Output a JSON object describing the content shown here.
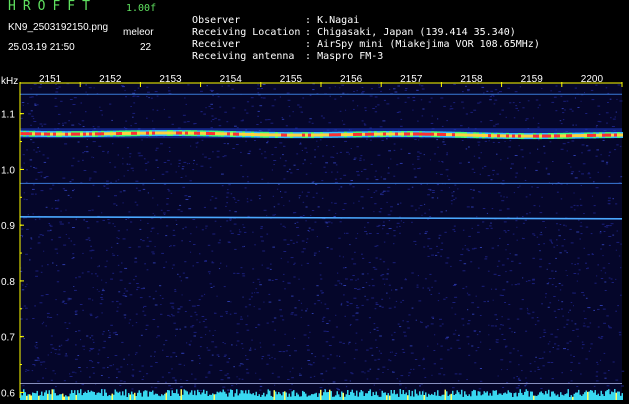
{
  "header": {
    "app_title": "HROFFT",
    "version": "1.00f",
    "filename": "KN9_2503192150.png",
    "mode": "meleor",
    "datetime": "25.03.19 21:50",
    "count": "22"
  },
  "station": {
    "rows": [
      {
        "label": "Observer",
        "value": ": K.Nagai"
      },
      {
        "label": "Receiving Location",
        "value": ": Chigasaki, Japan (139.414 35.340)"
      },
      {
        "label": "Receiver",
        "value": ": AirSpy mini (Miakejima VOR 108.65MHz)"
      },
      {
        "label": "Receiving antenna",
        "value": ": Maspro FM-3"
      }
    ]
  },
  "colors": {
    "background": "#000000",
    "axis": "#ffff00",
    "noise": "#1a1f7a",
    "signal_line": "#4aa8ff",
    "echo_core": "#ff3030",
    "echo_mid": "#ffd040",
    "echo_outer": "#40ff80",
    "floor": "#38d8f0"
  },
  "chart_data": {
    "type": "heatmap",
    "title": "",
    "xlabel": "",
    "ylabel": "kHz",
    "x_ticks": [
      "2151",
      "2152",
      "2153",
      "2154",
      "2155",
      "2156",
      "2157",
      "2158",
      "2159",
      "2200"
    ],
    "y_ticks": [
      "1.1",
      "1.0",
      "0.9",
      "0.8",
      "0.7",
      "0.6"
    ],
    "y_tick_values": [
      1.1,
      1.0,
      0.9,
      0.8,
      0.7,
      0.6
    ],
    "ylim": [
      0.59,
      1.155
    ],
    "carriers_khz": [
      {
        "freq": 1.135,
        "strength": "weak"
      },
      {
        "freq": 1.065,
        "strength": "strong"
      },
      {
        "freq": 0.975,
        "strength": "weak"
      },
      {
        "freq": 0.915,
        "strength": "medium"
      },
      {
        "freq": 0.616,
        "strength": "faint"
      }
    ]
  }
}
